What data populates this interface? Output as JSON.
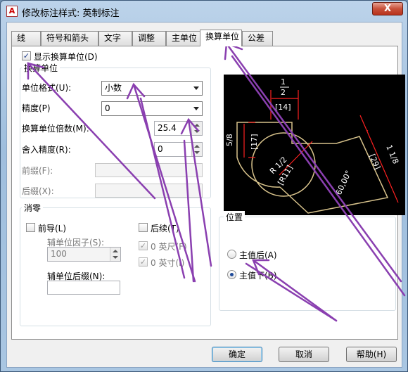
{
  "window": {
    "title": "修改标注样式: 英制标注",
    "app_icon": "autocad-icon",
    "close_label": "X"
  },
  "tabs": [
    {
      "label": "线",
      "active": false
    },
    {
      "label": "符号和箭头",
      "active": false
    },
    {
      "label": "文字",
      "active": false
    },
    {
      "label": "调整",
      "active": false
    },
    {
      "label": "主单位",
      "active": false
    },
    {
      "label": "换算单位",
      "active": true
    },
    {
      "label": "公差",
      "active": false
    }
  ],
  "display_alt": {
    "label": "显示换算单位(D)",
    "checked": true
  },
  "alt_units": {
    "group_title": "换算单位",
    "unit_format": {
      "label": "单位格式(U):",
      "value": "小数"
    },
    "precision": {
      "label": "精度(P)",
      "value": "0"
    },
    "multiplier": {
      "label": "换算单位倍数(M):",
      "value": "25.4"
    },
    "roundoff": {
      "label": "舍入精度(R):",
      "value": "0"
    },
    "prefix": {
      "label": "前缀(F):",
      "value": ""
    },
    "suffix": {
      "label": "后缀(X):",
      "value": ""
    }
  },
  "zero_suppression": {
    "group_title": "消零",
    "leading": {
      "label": "前导(L)",
      "checked": false
    },
    "sub_factor": {
      "label": "辅单位因子(S):",
      "value": "100"
    },
    "sub_suffix": {
      "label": "辅单位后缀(N):",
      "value": ""
    },
    "trailing": {
      "label": "后续(T)",
      "checked": false
    },
    "feet": {
      "label": "0 英尺(F)",
      "checked": true
    },
    "inches": {
      "label": "0 英寸(I)",
      "checked": true
    }
  },
  "placement": {
    "group_title": "位置",
    "after": {
      "label": "主值后(A)",
      "selected": false
    },
    "below": {
      "label": "主值下(B)",
      "selected": true
    }
  },
  "preview": {
    "top_num": "1",
    "top_den": "2",
    "top_alt": "[14]",
    "left_dim": "5/8",
    "left_alt": "[17]",
    "radius": "R 1/2",
    "radius_alt": "[R11]",
    "angle": "60,00°",
    "right_dim": "1 1/8",
    "right_alt": "[29]"
  },
  "buttons": {
    "ok": "确定",
    "cancel": "取消",
    "help": "帮助(H)"
  },
  "colors": {
    "annotation_arrow": "#8a3fb0",
    "preview_bg": "#000000",
    "dim_red": "#ff2020",
    "geometry_yellow": "#d8c38c"
  }
}
